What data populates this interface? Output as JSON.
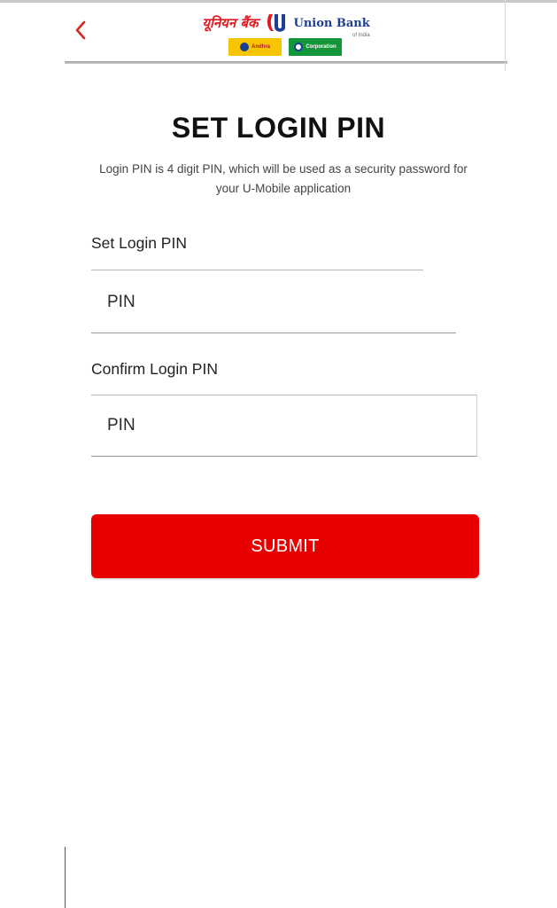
{
  "header": {
    "brand_hindi": "यूनियन बैंक",
    "brand_english": "Union Bank",
    "brand_sub": "of India",
    "partners": [
      {
        "name": "Andhra"
      },
      {
        "name": "Corporation"
      }
    ]
  },
  "page": {
    "title": "SET LOGIN PIN",
    "description": "Login PIN is 4 digit PIN, which will be used as a security password for your U-Mobile application"
  },
  "form": {
    "set_pin_label": "Set Login PIN",
    "set_pin_placeholder": "PIN",
    "confirm_pin_label": "Confirm Login PIN",
    "confirm_pin_placeholder": "PIN",
    "submit_label": "SUBMIT"
  },
  "colors": {
    "accent": "#e80000",
    "brand_red": "#e01b22",
    "brand_blue": "#1e3f93"
  },
  "icons": {
    "back": "chevron-left-icon",
    "logo": "union-bank-logo-icon"
  }
}
